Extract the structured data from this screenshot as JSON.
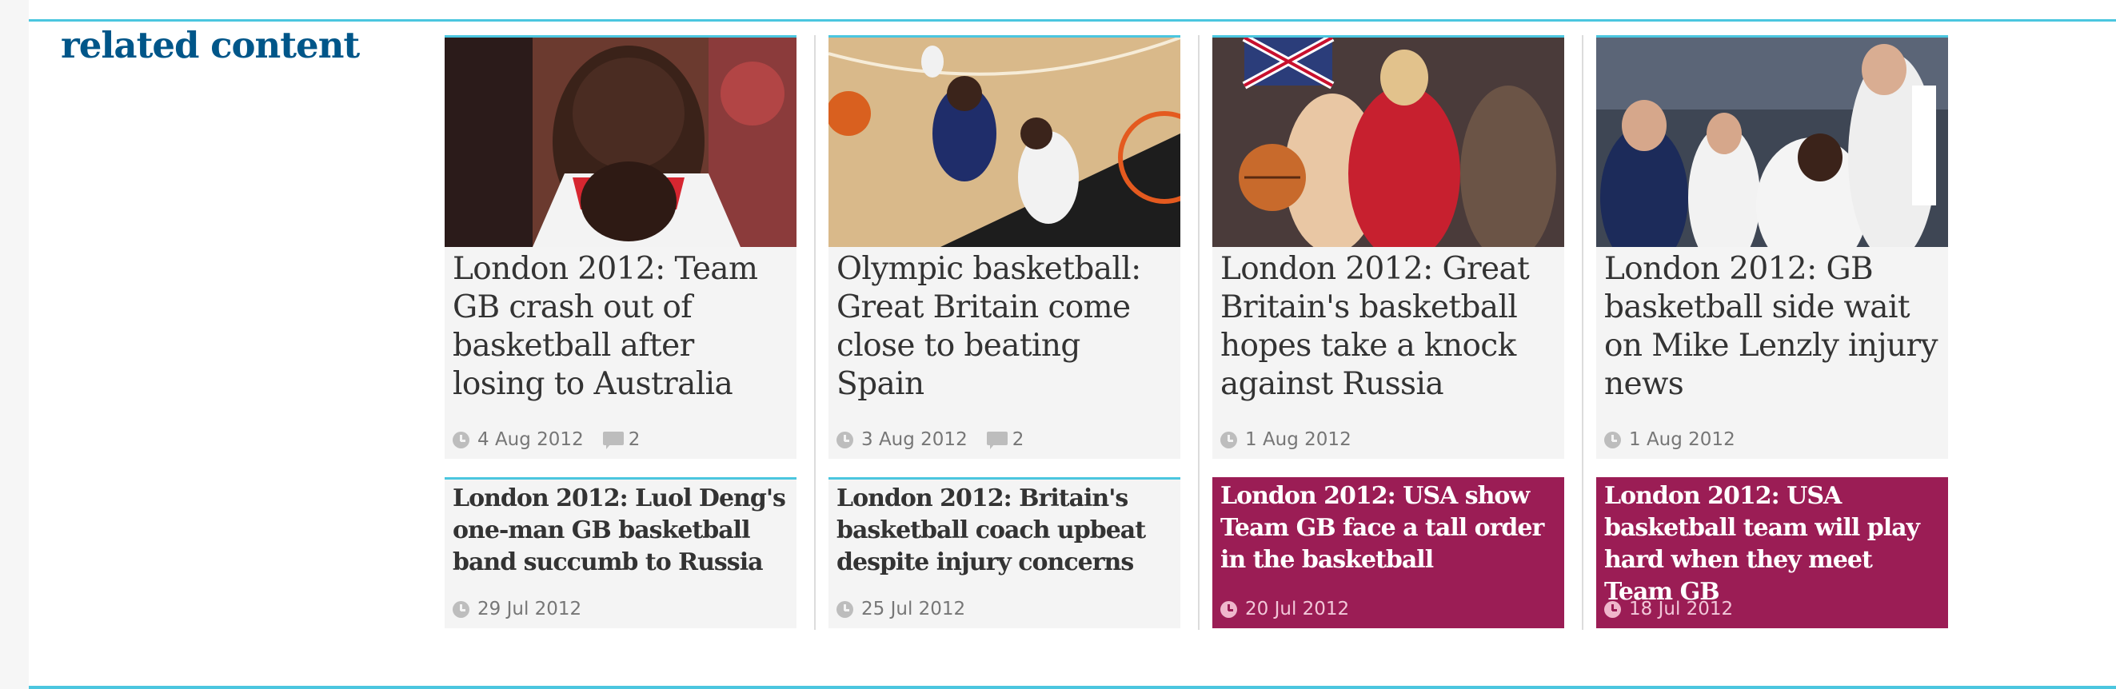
{
  "section": {
    "title": "related content"
  },
  "colors": {
    "accent": "#4bc6df",
    "title": "#005689",
    "media_bg": "#9b1d55"
  },
  "big_cards": [
    {
      "headline": "London 2012: Team GB crash out of basketball after losing to Australia",
      "date": "4 Aug 2012",
      "comments": "2",
      "image": "basketball player covering mouth with shirt"
    },
    {
      "headline": "Olympic basketball: Great Britain come close to beating Spain",
      "date": "3 Aug 2012",
      "comments": "2",
      "image": "aerial view of players going for a layup"
    },
    {
      "headline": "London 2012: Great Britain's basketball hopes take a knock against Russia",
      "date": "1 Aug 2012",
      "image": "women's basketball players contesting the ball"
    },
    {
      "headline": "London 2012: GB basketball side wait on Mike Lenzly injury news",
      "date": "1 Aug 2012",
      "image": "GB players and staff on court"
    }
  ],
  "small_cards": [
    {
      "headline": "London 2012: Luol Deng's one-man GB basketball band succumb to Russia",
      "date": "29 Jul 2012"
    },
    {
      "headline": "London 2012: Britain's basketball coach upbeat despite injury concerns",
      "date": "25 Jul 2012"
    },
    {
      "headline": "London 2012: USA show Team GB face a tall order in the basketball",
      "date": "20 Jul 2012"
    },
    {
      "headline": "London 2012: USA basketball team will play hard when they meet Team GB",
      "date": "18 Jul 2012"
    }
  ]
}
